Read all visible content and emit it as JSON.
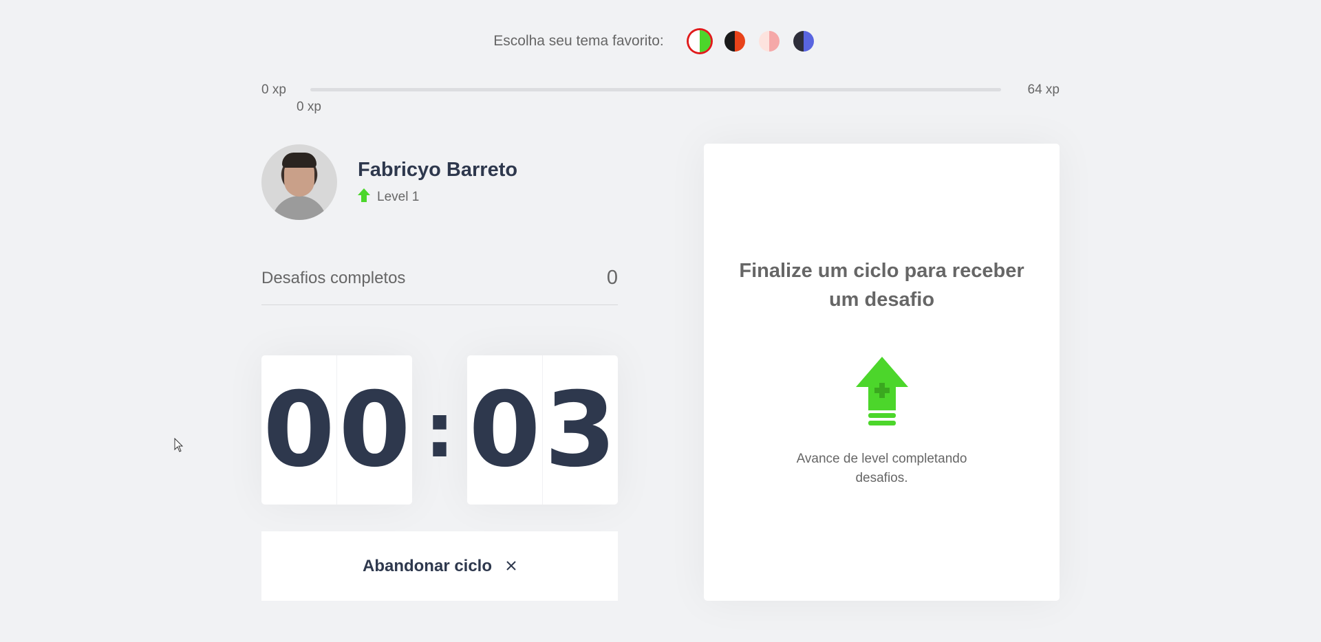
{
  "theme": {
    "label": "Escolha seu tema favorito:",
    "swatches": [
      {
        "name": "green",
        "left": "#ffffff",
        "right": "#4cd62b",
        "selected": true
      },
      {
        "name": "orange",
        "left": "#1a1a1a",
        "right": "#e8431a",
        "selected": false
      },
      {
        "name": "pink",
        "left": "#fde3de",
        "right": "#f5a8a8",
        "selected": false
      },
      {
        "name": "indigo",
        "left": "#2e2e3a",
        "right": "#5965e0",
        "selected": false
      }
    ]
  },
  "xp": {
    "min_label": "0 xp",
    "max_label": "64 xp",
    "current_label": "0 xp",
    "progress_fraction": 0
  },
  "profile": {
    "name": "Fabricyo Barreto",
    "level_label": "Level 1",
    "level_icon": "level-up-arrow-icon"
  },
  "challenges": {
    "label": "Desafios completos",
    "count": "0"
  },
  "countdown": {
    "minutes": [
      "0",
      "0"
    ],
    "separator": ":",
    "seconds": [
      "0",
      "3"
    ]
  },
  "abandon_button": {
    "label": "Abandonar ciclo",
    "icon": "close-icon"
  },
  "challenge_box": {
    "title": "Finalize um ciclo para receber um desafio",
    "icon": "level-up-icon",
    "description": "Avance de level completando desafios."
  },
  "colors": {
    "accent": "#4cd62b",
    "text": "#666666",
    "title": "#2e384d",
    "background": "#f1f2f4"
  }
}
